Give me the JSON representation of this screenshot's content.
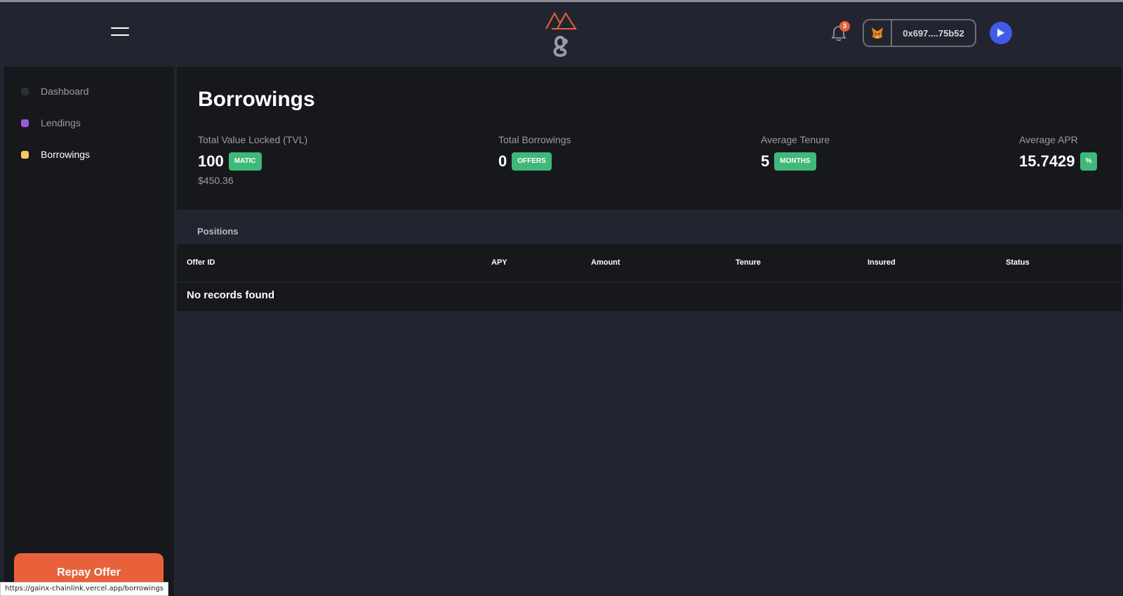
{
  "header": {
    "notification_count": "3",
    "wallet_address": "0x697....75b52"
  },
  "sidebar": {
    "items": [
      {
        "label": "Dashboard",
        "color": "#2b2e36",
        "active": false
      },
      {
        "label": "Lendings",
        "color": "#9b59e0",
        "active": false
      },
      {
        "label": "Borrowings",
        "color": "#f7c85a",
        "active": true
      }
    ],
    "repay_button": "Repay Offer"
  },
  "status_url": "https://gainx-chainlink.vercel.app/borrowings",
  "main": {
    "title": "Borrowings",
    "stats": [
      {
        "label": "Total Value Locked (TVL)",
        "value": "100",
        "unit": "MATIC",
        "sub": "$450.36"
      },
      {
        "label": "Total Borrowings",
        "value": "0",
        "unit": "OFFERS"
      },
      {
        "label": "Average Tenure",
        "value": "5",
        "unit": "MONTHS"
      },
      {
        "label": "Average APR",
        "value": "15.7429",
        "unit": "%"
      }
    ],
    "positions": {
      "label": "Positions",
      "columns": [
        "Offer ID",
        "APY",
        "Amount",
        "Tenure",
        "Insured",
        "Status"
      ],
      "empty_text": "No records found"
    }
  },
  "colors": {
    "accent": "#e8613a",
    "badge_green": "#3fb87a",
    "panel": "#17181c",
    "background": "#22252f"
  },
  "icons": {
    "menu": "hamburger-icon",
    "logo": "gainx-logo",
    "bell": "bell-icon",
    "wallet": "metamask-fox-icon",
    "profile": "profile-play-icon"
  }
}
